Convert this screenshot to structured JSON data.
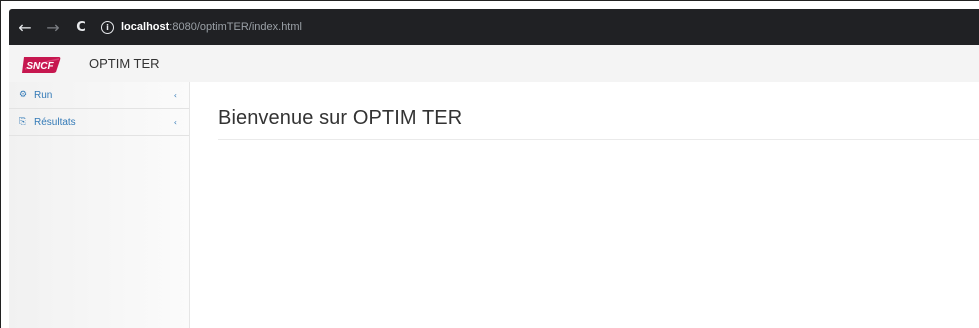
{
  "browser": {
    "back_glyph": "←",
    "forward_glyph": "→",
    "reload_glyph": "C",
    "url_host": "localhost",
    "url_rest": ":8080/optimTER/index.html"
  },
  "header": {
    "logo_text": "SNCF",
    "app_title": "OPTIM TER",
    "brand_color": "#c6174f"
  },
  "sidebar": {
    "items": [
      {
        "icon": "dashboard-icon",
        "glyph": "⚙",
        "label": "Run",
        "chevron": "‹"
      },
      {
        "icon": "copy-icon",
        "glyph": "⎘",
        "label": "Résultats",
        "chevron": "‹"
      }
    ]
  },
  "main": {
    "title": "Bienvenue sur OPTIM TER"
  }
}
